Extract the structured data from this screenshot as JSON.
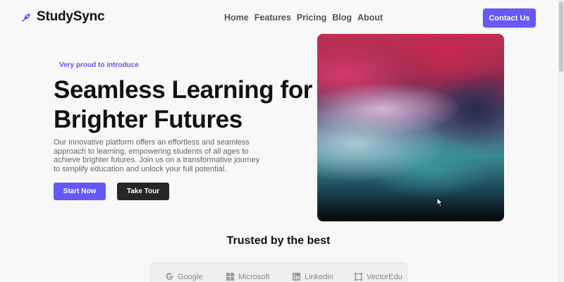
{
  "header": {
    "brand_name": "StudySync",
    "nav": [
      "Home",
      "Features",
      "Pricing",
      "Blog",
      "About"
    ],
    "contact_label": "Contact Us"
  },
  "hero": {
    "eyebrow": "Very proud to introduce",
    "headline": "Seamless Learning for Brighter Futures",
    "lead": "Our innovative platform offers an effortless and seamless approach to learning, empowering students of all ages to achieve brighter futures. Join us on a transformative journey to simplify education and unlock your full potential.",
    "primary_cta": "Start Now",
    "secondary_cta": "Take Tour"
  },
  "trusted": {
    "title": "Trusted by the best",
    "logos": [
      {
        "name": "Google",
        "icon": "google-icon"
      },
      {
        "name": "Microsoft",
        "icon": "microsoft-icon"
      },
      {
        "name": "Linkedin",
        "icon": "linkedin-icon"
      },
      {
        "name": "VectorEdu",
        "icon": "vector-icon"
      }
    ]
  },
  "colors": {
    "accent": "#6757f5",
    "dark_button": "#262626",
    "background": "#f8f8f9"
  }
}
